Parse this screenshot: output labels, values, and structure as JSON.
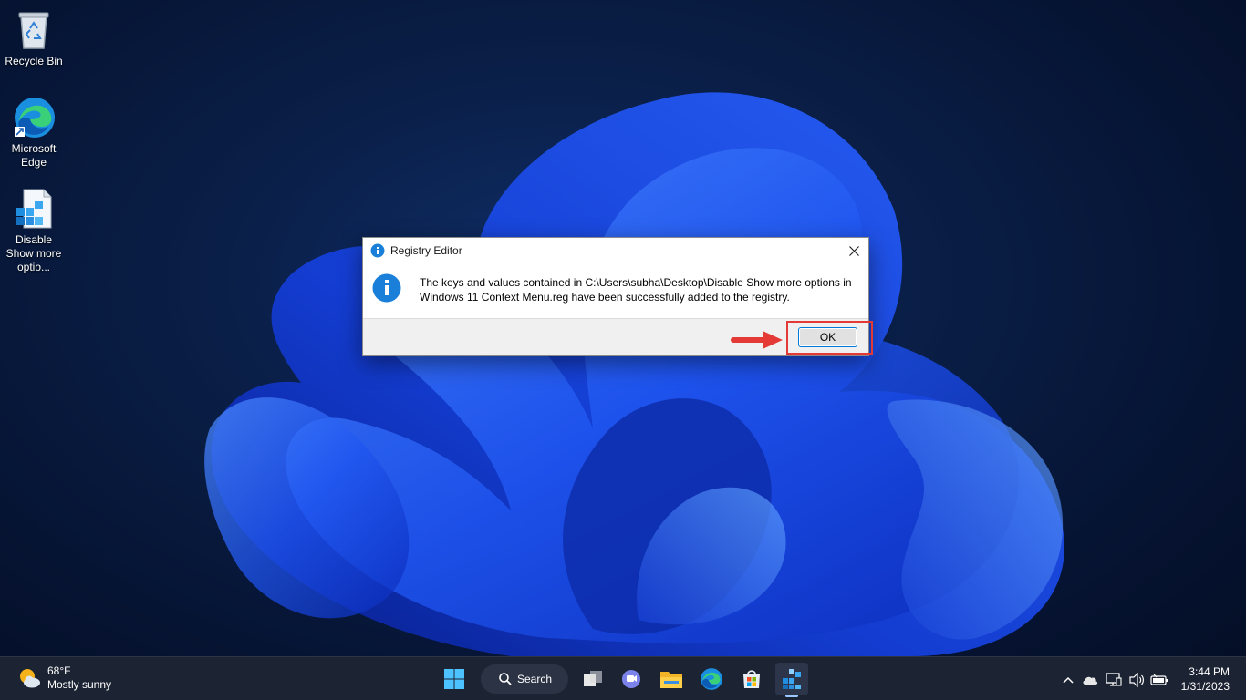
{
  "desktop": {
    "icons": [
      {
        "label": "Recycle Bin"
      },
      {
        "label": "Microsoft Edge"
      },
      {
        "label": "Disable Show more optio..."
      }
    ]
  },
  "dialog": {
    "title": "Registry Editor",
    "message": "The keys and values contained in C:\\Users\\subha\\Desktop\\Disable Show more options in Windows 11 Context Menu.reg have been successfully added to the registry.",
    "ok_label": "OK"
  },
  "taskbar": {
    "weather": {
      "temp": "68°F",
      "condition": "Mostly sunny"
    },
    "search_label": "Search",
    "apps": [
      "start-icon",
      "task-view-icon",
      "chat-icon",
      "file-explorer-icon",
      "edge-icon",
      "store-icon",
      "registry-editor-icon"
    ],
    "tray": [
      "chevron-up-icon",
      "onedrive-icon",
      "network-icon",
      "volume-icon",
      "battery-icon"
    ],
    "clock": {
      "time": "3:44 PM",
      "date": "1/31/2023"
    }
  },
  "colors": {
    "accent": "#0078d7",
    "highlight": "#e53935",
    "taskbar": "#1c2333"
  }
}
